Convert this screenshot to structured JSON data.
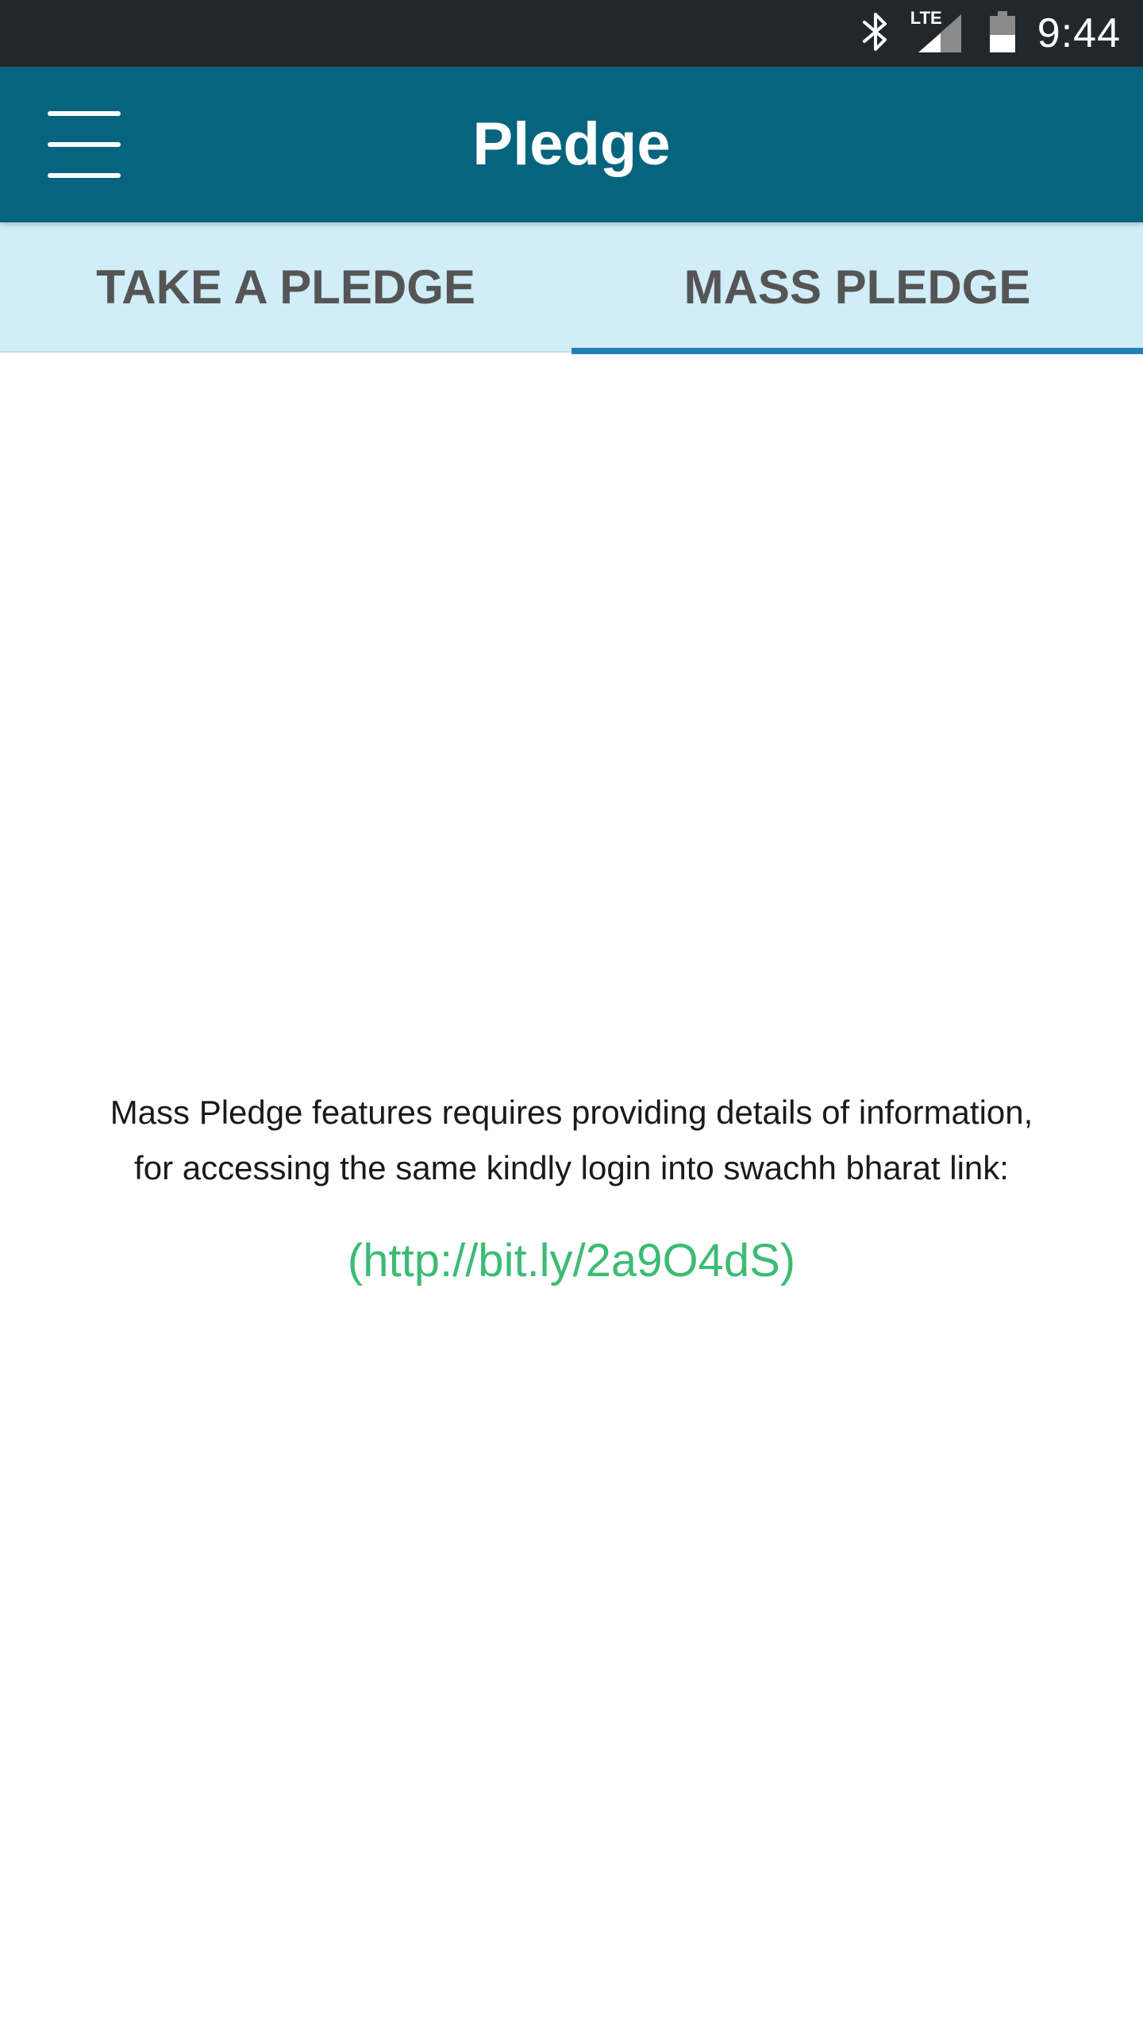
{
  "status_bar": {
    "time": "9:44",
    "network_label": "LTE",
    "icons": [
      "bluetooth-icon",
      "lte-signal-icon",
      "battery-icon"
    ]
  },
  "app_bar": {
    "title": "Pledge",
    "menu_icon": "hamburger-menu-icon",
    "background_color": "#06647e"
  },
  "tabs": [
    {
      "label": "TAKE A PLEDGE",
      "active": false
    },
    {
      "label": "MASS PLEDGE",
      "active": true
    }
  ],
  "content": {
    "message_line_1": "Mass Pledge features requires providing details of information,",
    "message_line_2": "for accessing the same kindly login into swachh bharat link:",
    "link_text": "(http://bit.ly/2a9O4dS)",
    "link_color": "#3dbb74"
  },
  "colors": {
    "tab_bar_bg": "#d0edf8",
    "tab_indicator": "#2180b8",
    "status_bar_bg": "#22272b"
  }
}
